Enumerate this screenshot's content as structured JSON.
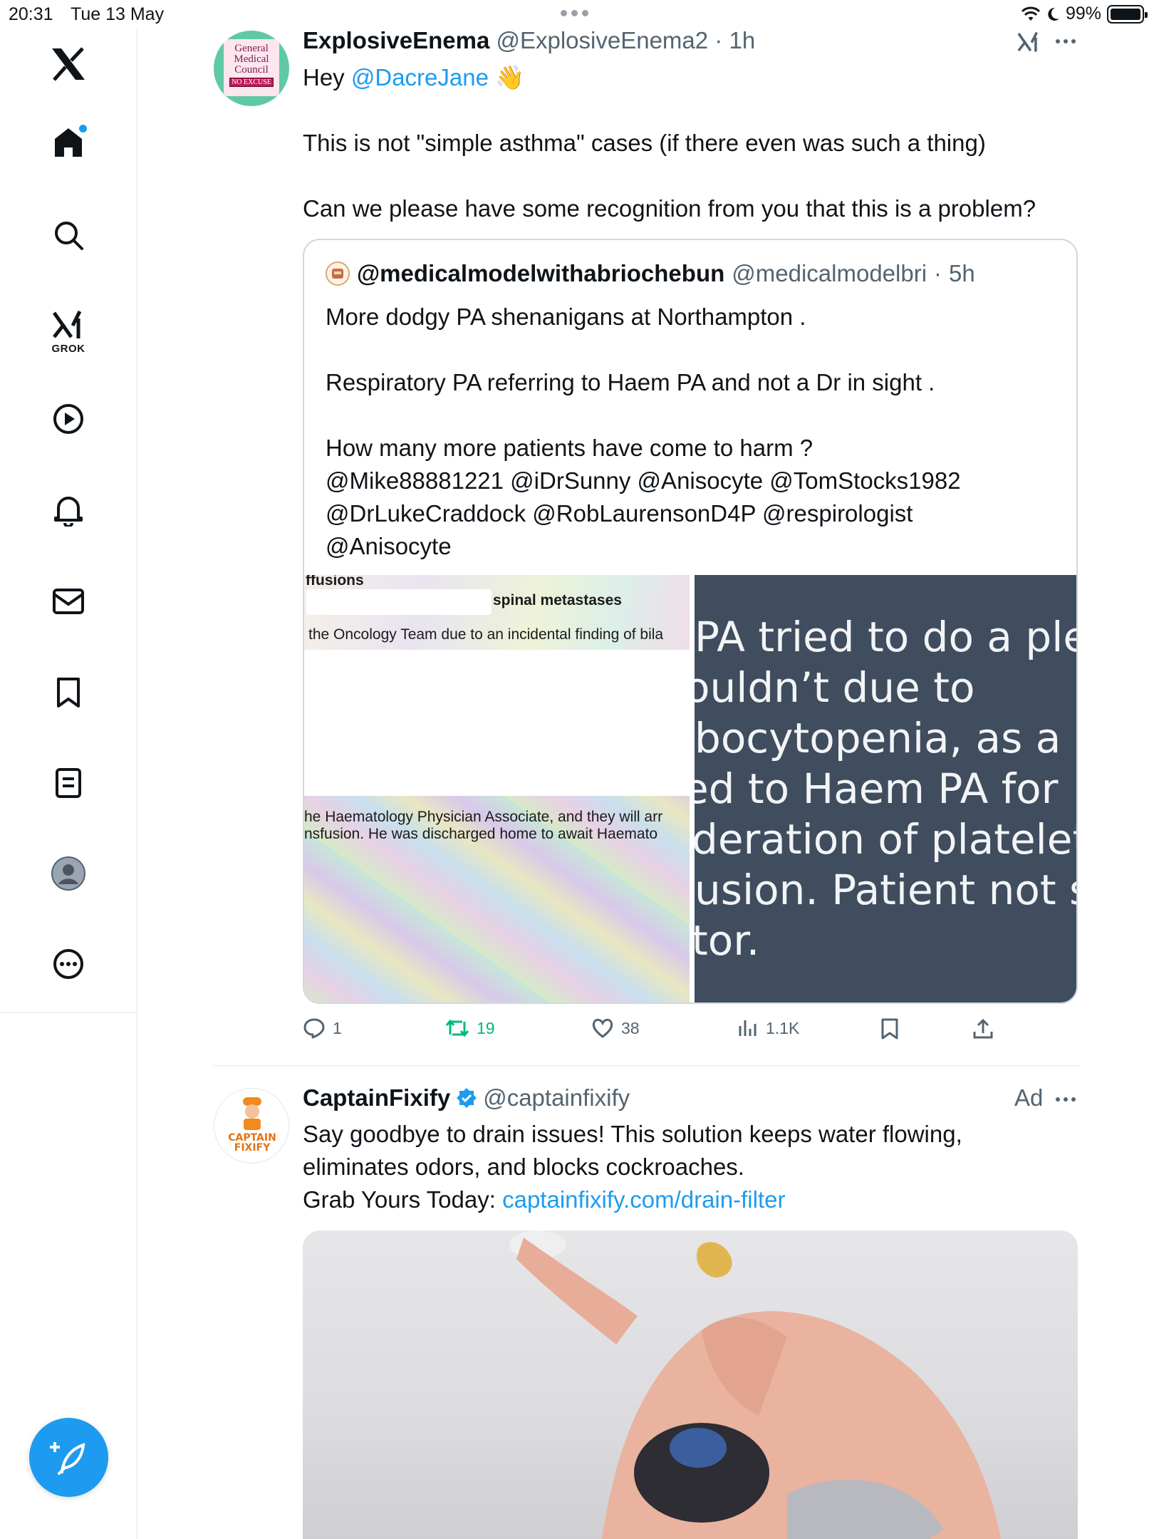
{
  "status_bar": {
    "time": "20:31",
    "date": "Tue 13 May",
    "battery": "99%"
  },
  "sidebar": {
    "grok_label": "GROK",
    "items": [
      "home",
      "search",
      "grok",
      "video",
      "notifications",
      "messages",
      "bookmarks",
      "lists",
      "profile",
      "more"
    ]
  },
  "tweet1": {
    "display_name": "ExplosiveEnema",
    "handle": "@ExplosiveEnema2",
    "separator": "·",
    "time": "1h",
    "avatar_text": [
      "General",
      "Medical",
      "Council",
      "NO",
      "EXCUSE"
    ],
    "line1_prefix": "Hey",
    "line1_mention": "@DacreJane",
    "line1_emoji": "👋",
    "line2": "This is not \"simple asthma\" cases (if there even was such a thing)",
    "line3": "Can we please have some recognition from you that this is a problem?",
    "quote": {
      "display_name": "@medicalmodelwithabriochebun",
      "handle": "@medicalmodelbri",
      "separator": "·",
      "time": "5h",
      "lines": [
        "More dodgy PA shenanigans at Northampton .",
        "",
        "Respiratory PA referring to Haem PA and not a Dr in sight .",
        "",
        "How many more patients have come to harm ?",
        "@Mike88881221 @iDrSunny @Anisocyte @TomStocks1982",
        "@DrLukeCraddock @RobLaurensonD4P @respirologist",
        "@Anisocyte"
      ],
      "image_left": {
        "top_label": "ffusions",
        "redacted_text": "spinal metastases",
        "line_a": "the Oncology Team due to an incidental finding of bila",
        "line_b": "he Haematology Physician Associate, and they will arr",
        "line_c": "nsfusion. He was discharged home to await Haemato"
      },
      "image_right": {
        "lines": [
          "PA tried to do a pleura",
          "ouldn’t due to",
          "bocytopenia, as a res",
          "ed to Haem PA for",
          "deration of platelet",
          "usion. Patient not see",
          "tor."
        ]
      }
    },
    "actions": {
      "replies": "1",
      "reposts": "19",
      "likes": "38",
      "views": "1.1K"
    }
  },
  "tweet2": {
    "display_name": "CaptainFixify",
    "handle": "@captainfixify",
    "ad_label": "Ad",
    "avatar_text": [
      "CAPTAIN",
      "FIXIFY"
    ],
    "line1": "Say goodbye to drain issues! This solution keeps water flowing,",
    "line2": "eliminates odors, and blocks cockroaches.",
    "line3_prefix": "Grab Yours Today:",
    "line3_link": "captainfixify.com/drain-filter"
  },
  "colors": {
    "accent": "#1d9bf0",
    "repost_green": "#00ba7c",
    "muted": "#536471",
    "border": "#cfd9de"
  }
}
